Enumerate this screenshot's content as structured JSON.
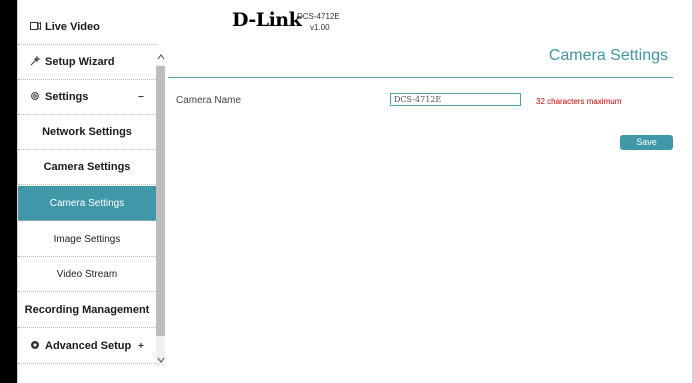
{
  "header": {
    "brand": "D-Link",
    "model": "DCS-4712E",
    "version": "v1.00"
  },
  "sidebar": {
    "items": [
      {
        "icon": "video-icon",
        "label": "Live Video"
      },
      {
        "icon": "wand-icon",
        "label": "Setup Wizard"
      },
      {
        "icon": "gear-icon",
        "label": "Settings",
        "sign": "−"
      }
    ],
    "settings_children": [
      {
        "label": "Network Settings"
      },
      {
        "label": "Camera Settings",
        "children": [
          {
            "label": "Camera Settings",
            "active": true
          },
          {
            "label": "Image Settings"
          },
          {
            "label": "Video Stream"
          }
        ]
      },
      {
        "label": "Recording Management"
      }
    ],
    "advanced": {
      "icon": "advanced-gear-icon",
      "label": "Advanced Setup",
      "sign": "+"
    }
  },
  "main": {
    "title": "Camera Settings",
    "camera_name_label": "Camera Name",
    "camera_name_value": "DCS-4712E",
    "hint": "32 characters maximum",
    "save_label": "Save"
  },
  "colors": {
    "accent": "#3f97a8",
    "hint": "#cc0000"
  }
}
